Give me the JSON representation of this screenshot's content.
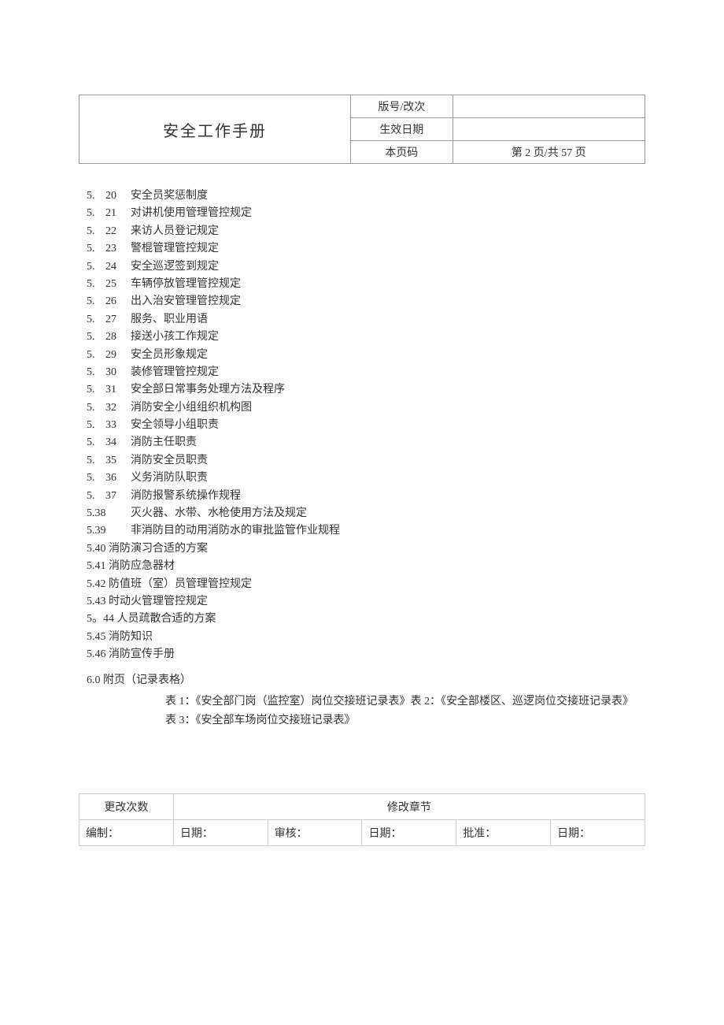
{
  "header": {
    "title": "安全工作手册",
    "row1_label": "版号/改次",
    "row1_value": "",
    "row2_label": "生效日期",
    "row2_value": "",
    "row3_label": "本页码",
    "row3_value": "第 2 页/共 57 页"
  },
  "toc_a": [
    {
      "p": "5.",
      "n": "20",
      "t": "安全员奖惩制度"
    },
    {
      "p": "5.",
      "n": "21",
      "t": "对讲机使用管理管控规定"
    },
    {
      "p": "5.",
      "n": "22",
      "t": "来访人员登记规定"
    },
    {
      "p": "5.",
      "n": "23",
      "t": "警棍管理管控规定"
    },
    {
      "p": "5.",
      "n": "24",
      "t": "安全巡逻签到规定"
    },
    {
      "p": "5.",
      "n": "25",
      "t": "车辆停放管理管控规定"
    },
    {
      "p": "5.",
      "n": "26",
      "t": "出入治安管理管控规定"
    },
    {
      "p": "5.",
      "n": "27",
      "t": "服务、职业用语"
    },
    {
      "p": "5.",
      "n": "28",
      "t": "接送小孩工作规定"
    },
    {
      "p": "5.",
      "n": "29",
      "t": "安全员形象规定"
    },
    {
      "p": "5.",
      "n": "30",
      "t": "装修管理管控规定"
    },
    {
      "p": "5.",
      "n": "31",
      "t": "安全部日常事务处理方法及程序"
    },
    {
      "p": "5.",
      "n": "32",
      "t": "消防安全小组组织机构图"
    },
    {
      "p": "5.",
      "n": "33",
      "t": "安全领导小组职责"
    },
    {
      "p": "5.",
      "n": "34",
      "t": "消防主任职责"
    },
    {
      "p": "5.",
      "n": "35",
      "t": "消防安全员职责"
    },
    {
      "p": "5.",
      "n": "36",
      "t": "义务消防队职责"
    },
    {
      "p": "5.",
      "n": "37",
      "t": "消防报警系统操作规程"
    }
  ],
  "toc_b": [
    {
      "p": "5.38",
      "t": "灭火器、水带、水枪使用方法及规定"
    },
    {
      "p": "5.39",
      "t": "非消防目的动用消防水的审批监管作业规程"
    }
  ],
  "toc_c": [
    "5.40 消防演习合适的方案",
    "5.41 消防应急器材",
    "5.42 防值班（室）员管理管控规定",
    "5.43 时动火管理管控规定",
    "5。44 人员疏散合适的方案",
    "5.45 消防知识",
    "5.46 消防宣传手册"
  ],
  "section6": "6.0 附页（记录表格）",
  "tables_line1": "表 1：《安全部门岗（监控室）岗位交接班记录表》表 2：《安全部楼区、巡逻岗位交接班记录表》",
  "tables_line2": "表 3：《安全部车场岗位交接班记录表》",
  "footer": {
    "row1_c1": "更改次数",
    "row1_c2": "修改章节",
    "row2": [
      "编制：",
      "日期：",
      "审核：",
      "日期：",
      "批准：",
      "日期："
    ]
  }
}
